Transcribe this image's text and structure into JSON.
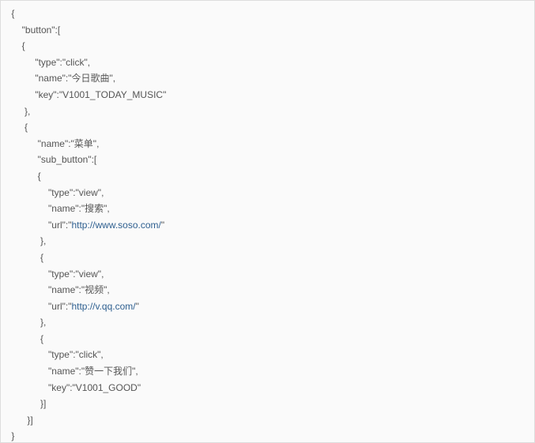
{
  "code": {
    "l1": " {",
    "l2": "     \"button\":[",
    "l3": "     {\t",
    "l4": "          \"type\":\"click\",",
    "l5": "          \"name\":\"今日歌曲\",",
    "l6": "          \"key\":\"V1001_TODAY_MUSIC\"",
    "l7": "      },",
    "l8": "      {",
    "l9": "           \"name\":\"菜单\",",
    "l10": "           \"sub_button\":[",
    "l11": "           {\t",
    "l12": "               \"type\":\"view\",",
    "l13": "               \"name\":\"搜索\",",
    "l14a": "               \"url\":\"",
    "l14b": "\"",
    "l15": "            },",
    "l16": "            {",
    "l17": "               \"type\":\"view\",",
    "l18": "               \"name\":\"视频\",",
    "l19a": "               \"url\":\"",
    "l19b": "\"",
    "l20": "            },",
    "l21": "            {",
    "l22": "               \"type\":\"click\",",
    "l23": "               \"name\":\"赞一下我们\",",
    "l24": "               \"key\":\"V1001_GOOD\"",
    "l25": "            }]",
    "l26": "       }]",
    "l27": " }"
  },
  "links": {
    "url1": "http://www.soso.com/",
    "url2": "http://v.qq.com/"
  }
}
